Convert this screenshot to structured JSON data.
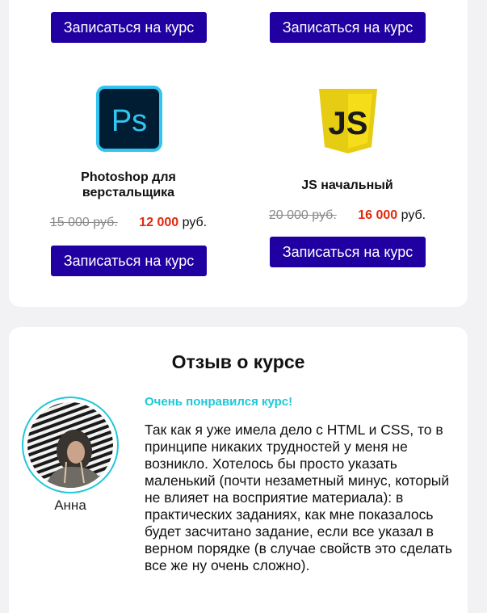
{
  "courses": [
    {
      "id": "top-left",
      "enroll_label": "Записаться на курс"
    },
    {
      "id": "top-right",
      "enroll_label": "Записаться на курс"
    },
    {
      "id": "photoshop",
      "icon": "photoshop-icon",
      "logo_text": "Ps",
      "title": "Photoshop для верстальщика",
      "old_price": "15 000 руб.",
      "new_price": "12 000",
      "currency": "руб.",
      "enroll_label": "Записаться на курс"
    },
    {
      "id": "js",
      "icon": "javascript-icon",
      "logo_text": "JS",
      "title": "JS начальный",
      "old_price": "20 000 руб.",
      "new_price": "16 000",
      "currency": "руб.",
      "enroll_label": "Записаться на курс"
    }
  ],
  "review": {
    "section_title": "Отзыв о курсе",
    "author": "Анна",
    "headline": "Очень понравился курс!",
    "text": "Так как я уже имела дело с HTML и CSS, то в принципе никаких трудностей у меня не возникло. Хотелось бы просто указать маленький (почти незаметный минус, который не влияет на восприятие материала): в практических заданиях, как мне показалось будет засчитано задание, если все указал в верном порядке (в случае свойств это сделать все же ну очень сложно)."
  },
  "colors": {
    "button": "#2000a0",
    "old_price": "#8a8a8a",
    "new_price": "#e2290e",
    "accent": "#1fc8d8",
    "photoshop_bg": "#001d34",
    "photoshop_border": "#31c5f0",
    "js_yellow": "#f5de19"
  }
}
